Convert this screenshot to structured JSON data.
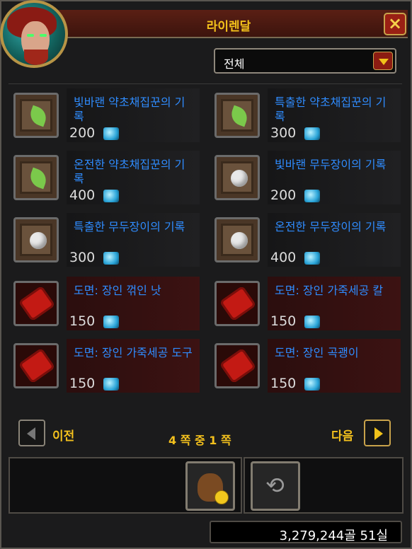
{
  "window": {
    "title": "라이렌달"
  },
  "filter": {
    "selected": "전체"
  },
  "items": [
    {
      "name": "빛바랜 약초채집꾼의 기록",
      "price": "200",
      "type": "herb"
    },
    {
      "name": "특출한 약초채집꾼의 기록",
      "price": "300",
      "type": "herb"
    },
    {
      "name": "온전한 약초채집꾼의 기록",
      "price": "400",
      "type": "herb"
    },
    {
      "name": "빛바랜 무두장이의 기록",
      "price": "200",
      "type": "wool"
    },
    {
      "name": "특출한 무두장이의 기록",
      "price": "300",
      "type": "wool"
    },
    {
      "name": "온전한 무두장이의 기록",
      "price": "400",
      "type": "wool"
    },
    {
      "name": "도면: 장인 꺾인 낫",
      "price": "150",
      "type": "recipe"
    },
    {
      "name": "도면: 장인 가죽세공 칼",
      "price": "150",
      "type": "recipe"
    },
    {
      "name": "도면: 장인 가죽세공 도구",
      "price": "150",
      "type": "recipe"
    },
    {
      "name": "도면: 장인 곡괭이",
      "price": "150",
      "type": "recipe"
    }
  ],
  "pagination": {
    "prev_label": "이전",
    "next_label": "다음",
    "page_text": "4 쪽 중 1 쪽"
  },
  "money": {
    "display": "3,279,244골 51실"
  }
}
